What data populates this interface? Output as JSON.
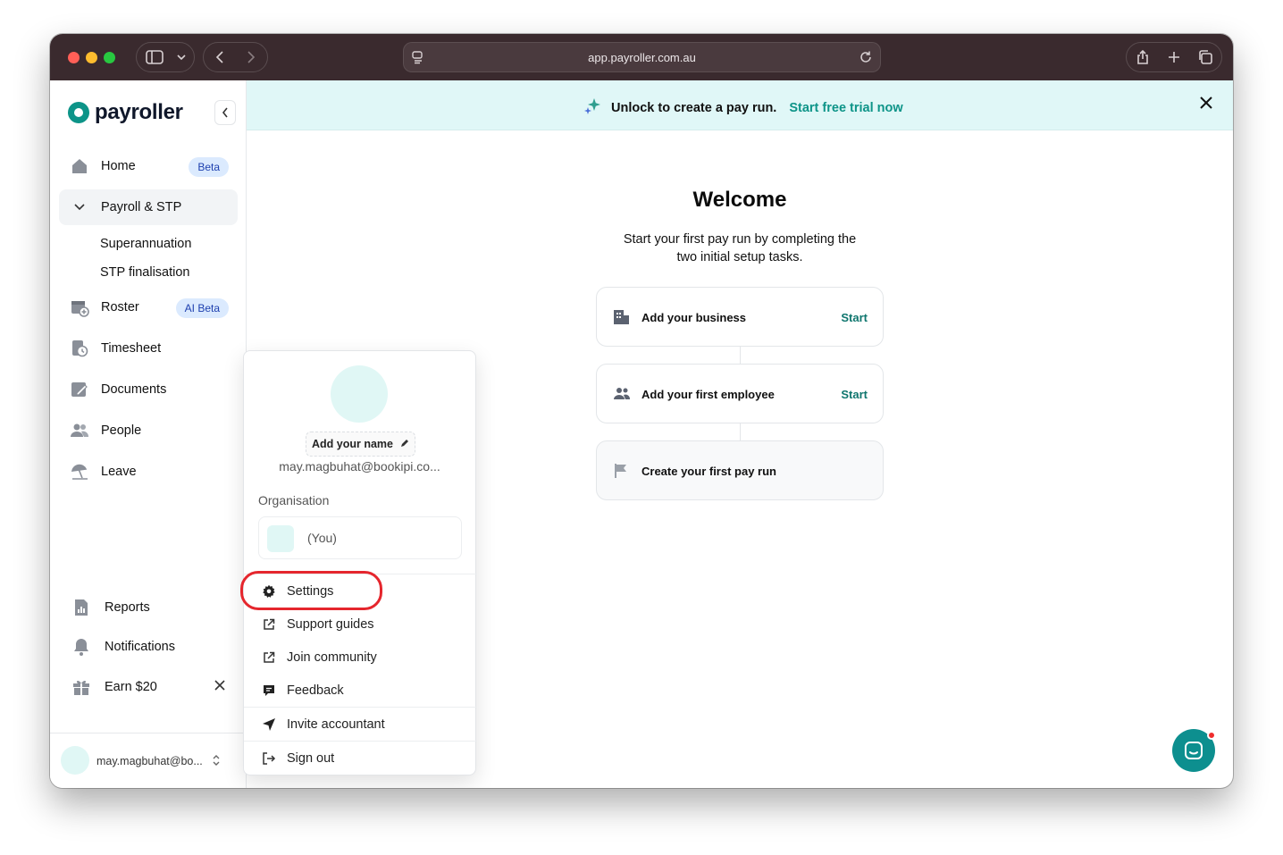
{
  "browser": {
    "url": "app.payroller.com.au"
  },
  "app": {
    "logo_text": "payroller",
    "brand_color": "#0d9488"
  },
  "sidebar": {
    "items": [
      {
        "label": "Home",
        "icon": "home-icon",
        "badge": "Beta"
      },
      {
        "label": "Payroll & STP",
        "icon": "chevron-down-icon"
      },
      {
        "label": "Roster",
        "icon": "calendar-icon",
        "badge": "AI Beta"
      },
      {
        "label": "Timesheet",
        "icon": "timesheet-icon"
      },
      {
        "label": "Documents",
        "icon": "documents-icon"
      },
      {
        "label": "People",
        "icon": "people-icon"
      },
      {
        "label": "Leave",
        "icon": "beach-umbrella-icon"
      }
    ],
    "subitems": [
      "Superannuation",
      "STP finalisation"
    ],
    "bottom_items": [
      {
        "label": "Reports",
        "icon": "reports-icon"
      },
      {
        "label": "Notifications",
        "icon": "bell-icon"
      },
      {
        "label": "Earn $20",
        "icon": "gift-icon"
      }
    ],
    "user_email": "may.magbuhat@bo..."
  },
  "banner": {
    "text": "Unlock to create a pay run.",
    "link": "Start free trial now"
  },
  "main": {
    "title": "Welcome",
    "subtitle_line1": "Start your first pay run by completing the",
    "subtitle_line2": "two initial setup tasks.",
    "tasks": [
      {
        "label": "Add your business",
        "action": "Start",
        "icon": "building-icon"
      },
      {
        "label": "Add your first employee",
        "action": "Start",
        "icon": "people-icon"
      },
      {
        "label": "Create your first pay run",
        "action": "",
        "icon": "flag-icon"
      }
    ]
  },
  "user_menu": {
    "add_name": "Add your name",
    "email": "may.magbuhat@bookipi.co...",
    "org_label": "Organisation",
    "org_you": "(You)",
    "items": [
      {
        "label": "Settings",
        "icon": "gear-icon"
      },
      {
        "label": "Support guides",
        "icon": "external-link-icon"
      },
      {
        "label": "Join community",
        "icon": "external-link-icon"
      },
      {
        "label": "Feedback",
        "icon": "chat-bubble-icon"
      },
      {
        "label": "Invite accountant",
        "icon": "send-icon"
      },
      {
        "label": "Sign out",
        "icon": "sign-out-icon"
      }
    ],
    "highlight_color": "#e5262d"
  }
}
